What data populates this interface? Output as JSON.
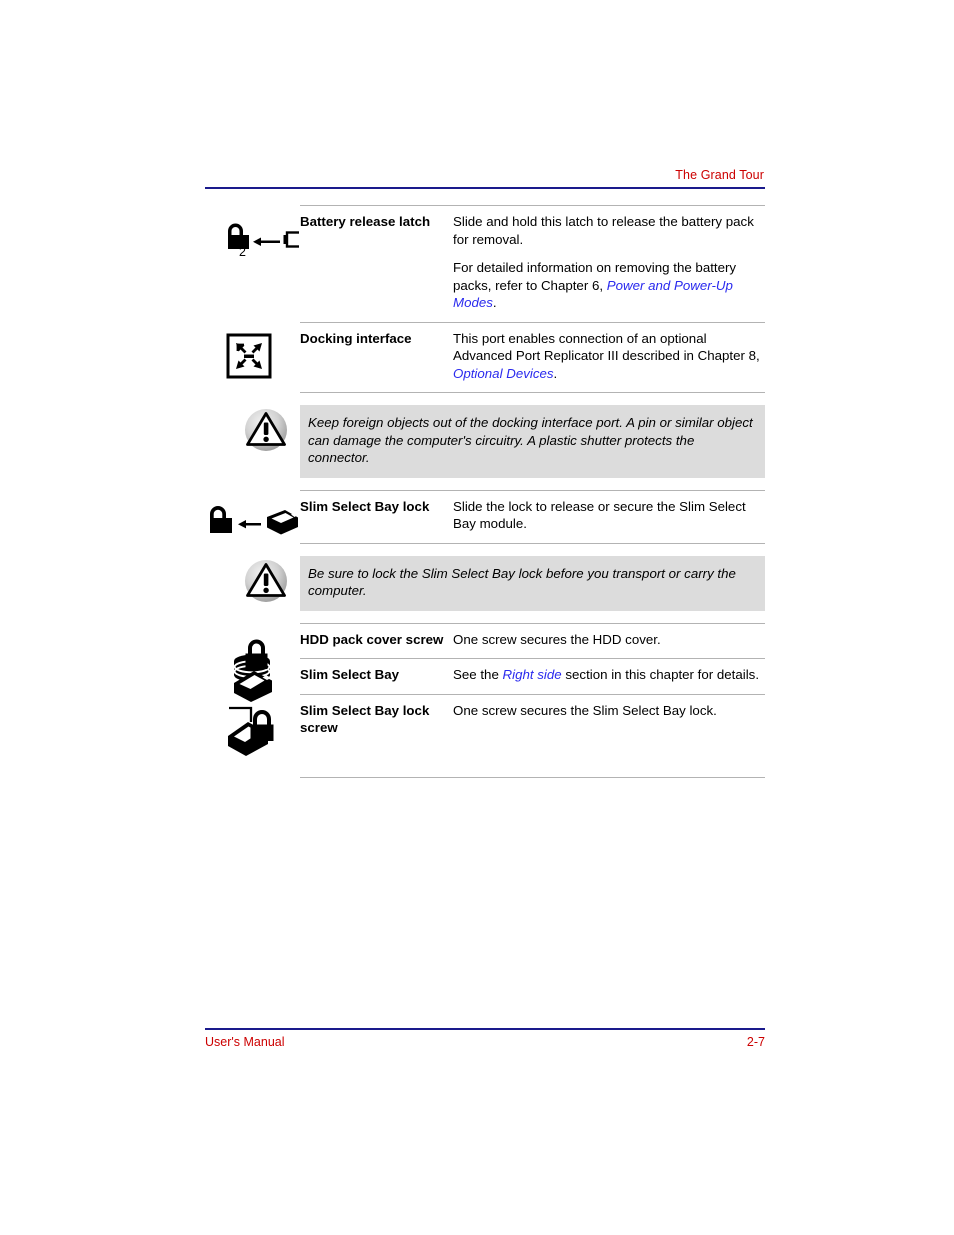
{
  "header": {
    "title": "The Grand Tour"
  },
  "footer": {
    "manual_label": "User's Manual",
    "page_number": "2-7"
  },
  "colors": {
    "header_text": "#cc0000",
    "header_rule": "#1a1a8c",
    "link": "#2a2aee",
    "caution_background": "#dcdcdc",
    "table_rule": "#b3b3b3"
  },
  "rows": [
    {
      "icon": "unlock-arrow-battery-icon",
      "icon_label": "2",
      "term": "Battery release latch",
      "paragraphs": [
        {
          "parts": [
            {
              "text": "Slide and hold this latch to release the battery pack for removal.",
              "style": "plain"
            }
          ]
        },
        {
          "parts": [
            {
              "text": "For detailed information on removing the battery packs, refer to Chapter 6, ",
              "style": "plain"
            },
            {
              "text": "Power and Power-Up Modes",
              "style": "link"
            },
            {
              "text": ".",
              "style": "plain"
            }
          ]
        }
      ]
    },
    {
      "icon": "docking-interface-icon",
      "term": "Docking interface",
      "paragraphs": [
        {
          "parts": [
            {
              "text": "This port enables connection of an optional Advanced Port Replicator III described in Chapter 8, ",
              "style": "plain"
            },
            {
              "text": "Optional Devices",
              "style": "link"
            },
            {
              "text": ".",
              "style": "plain"
            }
          ]
        }
      ]
    },
    {
      "icon": "unlock-arrow-module-icon",
      "term": "Slim Select Bay lock",
      "paragraphs": [
        {
          "parts": [
            {
              "text": "Slide the lock to release or secure the Slim Select Bay module.",
              "style": "plain"
            }
          ]
        }
      ]
    },
    {
      "icon": "hdd-lock-icon",
      "term": "HDD pack cover screw",
      "paragraphs": [
        {
          "parts": [
            {
              "text": "One screw secures the HDD cover.",
              "style": "plain"
            }
          ]
        }
      ]
    },
    {
      "icon": "module-icon",
      "term": "Slim Select Bay",
      "paragraphs": [
        {
          "parts": [
            {
              "text": "See the ",
              "style": "plain"
            },
            {
              "text": "Right side",
              "style": "link"
            },
            {
              "text": " section in this chapter for details.",
              "style": "plain"
            }
          ]
        }
      ]
    },
    {
      "icon": "module-lock-screw-icon",
      "term": "Slim Select Bay lock screw",
      "paragraphs": [
        {
          "parts": [
            {
              "text": "One screw secures the Slim Select Bay lock.",
              "style": "plain"
            }
          ]
        }
      ]
    }
  ],
  "cautions": [
    {
      "icon": "warning-triangle-icon",
      "text": "Keep foreign objects out of the docking interface port. A pin or similar object can damage the computer's circuitry. A plastic shutter protects the connector."
    },
    {
      "icon": "warning-triangle-icon",
      "text": "Be sure to lock the Slim Select Bay lock before you transport or carry the computer."
    }
  ]
}
